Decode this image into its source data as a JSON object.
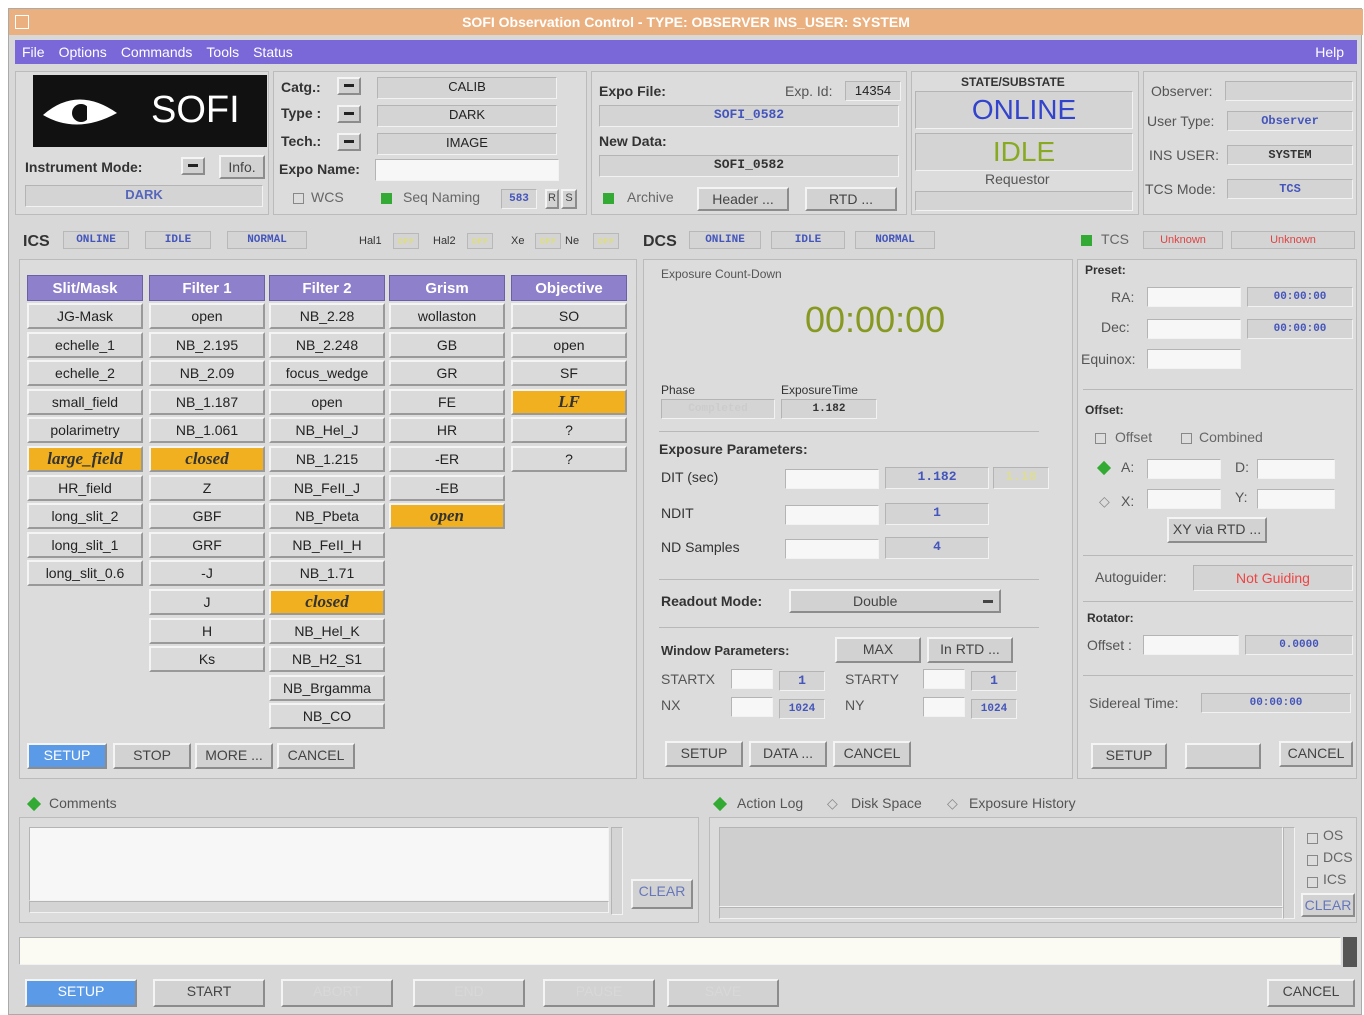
{
  "window": {
    "title": "SOFI Observation Control - TYPE: OBSERVER INS_USER: SYSTEM"
  },
  "menu": {
    "file": "File",
    "options": "Options",
    "commands": "Commands",
    "tools": "Tools",
    "status": "Status",
    "help": "Help"
  },
  "logo": {
    "text": "SOFI"
  },
  "instrument": {
    "mode_label": "Instrument Mode:",
    "info": "Info.",
    "mode_value": "DARK"
  },
  "catg": {
    "catg_label": "Catg.:",
    "type_label": "Type :",
    "tech_label": "Tech.:",
    "catg_value": "CALIB",
    "type_value": "DARK",
    "tech_value": "IMAGE",
    "expo_name_label": "Expo Name:",
    "wcs": "WCS",
    "seq_naming": "Seq Naming",
    "seq_value": "583",
    "r": "R",
    "s": "S"
  },
  "expo": {
    "file_label": "Expo File:",
    "expo_id_label": "Exp. Id:",
    "expo_id_value": "14354",
    "file_value": "SOFI_0582",
    "new_data_label": "New Data:",
    "new_data_value": "SOFI_0582",
    "archive": "Archive",
    "header_btn": "Header ...",
    "rtd_btn": "RTD ..."
  },
  "state": {
    "heading": "STATE/SUBSTATE",
    "online": "ONLINE",
    "idle": "IDLE",
    "requestor": "Requestor"
  },
  "user": {
    "observer_label": "Observer:",
    "user_type_label": "User Type:",
    "user_type_value": "Observer",
    "ins_user_label": "INS USER:",
    "ins_user_value": "SYSTEM",
    "tcs_mode_label": "TCS Mode:",
    "tcs_mode_value": "TCS"
  },
  "ics": {
    "label": "ICS",
    "s1": "ONLINE",
    "s2": "IDLE",
    "s3": "NORMAL",
    "hal1": "Hal1",
    "hal2": "Hal2",
    "xe": "Xe",
    "ne": "Ne",
    "off": "OFF"
  },
  "dcs": {
    "label": "DCS",
    "s1": "ONLINE",
    "s2": "IDLE",
    "s3": "NORMAL"
  },
  "tcs": {
    "label": "TCS",
    "s1": "Unknown",
    "s2": "Unknown"
  },
  "columns": {
    "slit": {
      "header": "Slit/Mask",
      "items": [
        "JG-Mask",
        "echelle_1",
        "echelle_2",
        "small_field",
        "polarimetry",
        "large_field",
        "HR_field",
        "long_slit_2",
        "long_slit_1",
        "long_slit_0.6"
      ]
    },
    "filter1": {
      "header": "Filter 1",
      "items": [
        "open",
        "NB_2.195",
        "NB_2.09",
        "NB_1.187",
        "NB_1.061",
        "closed",
        "Z",
        "GBF",
        "GRF",
        "-J",
        "J",
        "H",
        "Ks"
      ]
    },
    "filter2": {
      "header": "Filter 2",
      "items": [
        "NB_2.28",
        "NB_2.248",
        "focus_wedge",
        "open",
        "NB_Hel_J",
        "NB_1.215",
        "NB_FeII_J",
        "NB_Pbeta",
        "NB_FeII_H",
        "NB_1.71",
        "closed",
        "NB_Hel_K",
        "NB_H2_S1",
        "NB_Brgamma",
        "NB_CO"
      ]
    },
    "grism": {
      "header": "Grism",
      "items": [
        "wollaston",
        "GB",
        "GR",
        "FE",
        "HR",
        "-ER",
        "-EB",
        "open"
      ]
    },
    "objective": {
      "header": "Objective",
      "items": [
        "SO",
        "open",
        "SF",
        "LF",
        "?",
        "?"
      ]
    }
  },
  "ics_buttons": {
    "setup": "SETUP",
    "stop": "STOP",
    "more": "MORE ...",
    "cancel": "CANCEL"
  },
  "exposure": {
    "countdown_label": "Exposure Count-Down",
    "countdown": "00:00:00",
    "phase_label": "Phase",
    "phase_value": "Completed",
    "exptime_label": "ExposureTime",
    "exptime_value": "1.182",
    "params_label": "Exposure Parameters:",
    "dit_label": "DIT (sec)",
    "dit_value": "1.182",
    "dit_value2": "1.18",
    "ndit_label": "NDIT",
    "ndit_value": "1",
    "nd_label": "ND Samples",
    "nd_value": "4",
    "readout_label": "Readout Mode:",
    "readout_value": "Double",
    "window_label": "Window Parameters:",
    "max": "MAX",
    "in_rtd": "In RTD ...",
    "startx_label": "STARTX",
    "startx_value": "1",
    "starty_label": "STARTY",
    "starty_value": "1",
    "nx_label": "NX",
    "nx_value": "1024",
    "ny_label": "NY",
    "ny_value": "1024",
    "setup": "SETUP",
    "data": "DATA ...",
    "cancel": "CANCEL"
  },
  "preset": {
    "label": "Preset:",
    "ra_label": "RA:",
    "ra_value": "00:00:00",
    "dec_label": "Dec:",
    "dec_value": "00:00:00",
    "equinox_label": "Equinox:",
    "offset_label": "Offset:",
    "offset_chk": "Offset",
    "combined_chk": "Combined",
    "a_label": "A:",
    "d_label": "D:",
    "x_label": "X:",
    "y_label": "Y:",
    "xy_rtd": "XY via RTD ...",
    "autoguider_label": "Autoguider:",
    "autoguider_value": "Not Guiding",
    "rotator_label": "Rotator:",
    "rot_offset_label": "Offset :",
    "rot_offset_value": "0.0000",
    "sidereal_label": "Sidereal Time:",
    "sidereal_value": "00:00:00",
    "setup": "SETUP",
    "cancel": "CANCEL"
  },
  "comments": {
    "label": "Comments",
    "clear": "CLEAR"
  },
  "log": {
    "action_log": "Action Log",
    "disk_space": "Disk Space",
    "exposure_history": "Exposure History",
    "os": "OS",
    "dcs": "DCS",
    "ics": "ICS",
    "clear": "CLEAR"
  },
  "bottom": {
    "setup": "SETUP",
    "start": "START",
    "abort": "ABORT",
    "end": "END",
    "pause": "PAUSE",
    "save": "SAVE",
    "cancel": "CANCEL"
  },
  "colors": {
    "menu": "#7a67d8",
    "title": "#ebb080",
    "header": "#8f80cc",
    "selected": "#f0b020",
    "blue": "#5a9ae6"
  }
}
